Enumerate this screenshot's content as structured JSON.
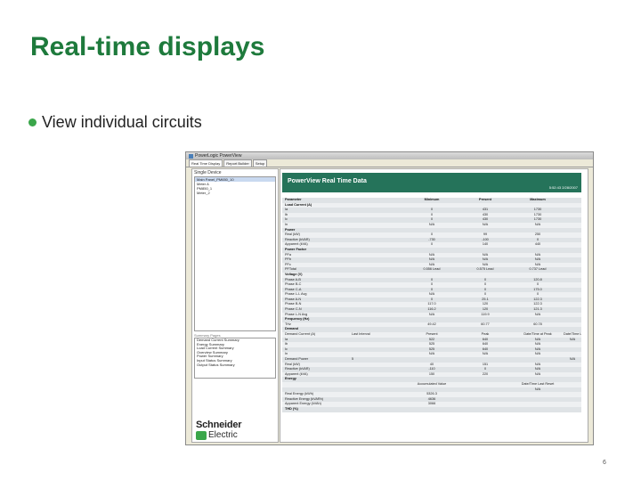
{
  "slide": {
    "title": "Real-time displays",
    "bullet": "View individual circuits",
    "number": "6",
    "accent_color": "#1e7a3c"
  },
  "window": {
    "title": "PowerLogic PowerView",
    "tabs": [
      "Real Time Display",
      "Report Builder",
      "Setup"
    ],
    "left_pane_header": "Single Device",
    "devices": [
      "Main Panel_PM650_10",
      "Meter A",
      "PM850_1",
      "Meter_2"
    ],
    "summary_header": "Summary Pages",
    "summary_pages": [
      "Demand Current Summary",
      "Energy Summary",
      "Load Current Summary",
      "Overview Summary",
      "Power Summary",
      "Input Status Summary",
      "Output Status Summary"
    ],
    "logo_line1": "Schneider",
    "logo_line2": "Electric"
  },
  "realtime": {
    "title": "PowerView Real Time Data",
    "timestamp": "5:52:43 2/28/2007",
    "headers": [
      "Parameter",
      "",
      "Minimum",
      "Present",
      "Maximum",
      ""
    ],
    "rows": [
      [
        "Load Current (A)",
        "",
        "",
        "",
        "",
        ""
      ],
      [
        "Ia",
        "",
        "0",
        "431",
        "1730",
        ""
      ],
      [
        "Ib",
        "",
        "0",
        "430",
        "1730",
        ""
      ],
      [
        "Ic",
        "",
        "0",
        "430",
        "1730",
        ""
      ],
      [
        "In",
        "",
        "N/A",
        "N/A",
        "N/A",
        ""
      ],
      [
        "Power",
        "",
        "",
        "",
        "",
        ""
      ],
      [
        "Real (kW)",
        "",
        "0",
        "99",
        "250",
        ""
      ],
      [
        "Reactive (kVAR)",
        "",
        "-730",
        "-100",
        "0",
        ""
      ],
      [
        "Apparent (kVA)",
        "",
        "0",
        "140",
        "440",
        ""
      ],
      [
        "Power Factor",
        "",
        "",
        "",
        "",
        ""
      ],
      [
        "PFa",
        "",
        "N/A",
        "N/A",
        "N/A",
        ""
      ],
      [
        "PFb",
        "",
        "N/A",
        "N/A",
        "N/A",
        ""
      ],
      [
        "PFc",
        "",
        "N/A",
        "N/A",
        "N/A",
        ""
      ],
      [
        "PFTotal",
        "",
        "0.556 Lead",
        "0.575 Lead",
        "0.737 Lead",
        ""
      ],
      [
        "Voltage (V)",
        "",
        "",
        "",
        "",
        ""
      ],
      [
        "Phase A-B",
        "",
        "0",
        "0",
        "120.8",
        ""
      ],
      [
        "Phase B-C",
        "",
        "0",
        "0",
        "0",
        ""
      ],
      [
        "Phase C-A",
        "",
        "0",
        "0",
        "175.0",
        ""
      ],
      [
        "Phase L-L Avg",
        "",
        "N/A",
        "0",
        "0",
        ""
      ],
      [
        "Phase A-N",
        "",
        "0",
        "25.1",
        "122.3",
        ""
      ],
      [
        "Phase B-N",
        "",
        "117.0",
        "120",
        "122.3",
        ""
      ],
      [
        "Phase C-N",
        "",
        "116.2",
        "120",
        "121.3",
        ""
      ],
      [
        "Phase L-N Avg",
        "",
        "N/A",
        "119.9",
        "N/A",
        ""
      ],
      [
        "Frequency (Hz)",
        "",
        "",
        "",
        "",
        ""
      ],
      [
        "THz",
        "",
        "49.42",
        "60.77",
        "60.78",
        ""
      ],
      [
        "Demand",
        "",
        "",
        "",
        "",
        ""
      ],
      [
        "Demand Current (A)",
        "Last Interval",
        "Present",
        "Peak",
        "Date/Time at Peak",
        "Date/Time Last Reset"
      ],
      [
        "Ia",
        "",
        "522",
        "640",
        "N/A",
        "N/A"
      ],
      [
        "Ib",
        "",
        "525",
        "640",
        "N/A",
        ""
      ],
      [
        "Ic",
        "",
        "525",
        "640",
        "N/A",
        ""
      ],
      [
        "In",
        "",
        "N/A",
        "N/A",
        "N/A",
        ""
      ],
      [
        "Demand Power",
        "5",
        "",
        "",
        "",
        "N/A"
      ],
      [
        "Real (kW)",
        "",
        "40",
        "151",
        "N/A",
        ""
      ],
      [
        "Reactive (kVAR)",
        "",
        "-110",
        "0",
        "N/A",
        ""
      ],
      [
        "Apparent (kVA)",
        "",
        "150",
        "220",
        "N/A",
        ""
      ],
      [
        "Energy",
        "",
        "",
        "",
        "",
        ""
      ],
      [
        "",
        "",
        "Accumulated Value",
        "",
        "Date/Time Last Reset",
        ""
      ],
      [
        "",
        "",
        "",
        "",
        "N/A",
        ""
      ],
      [
        "Real Energy (kWh)",
        "",
        "5326.3",
        "",
        "",
        ""
      ],
      [
        "Reactive Energy (kVARh)",
        "",
        "4636",
        "",
        "",
        ""
      ],
      [
        "Apparent Energy (kVAh)",
        "",
        "3066",
        "",
        "",
        ""
      ],
      [
        "THD (%)",
        "",
        "",
        "",
        "",
        ""
      ]
    ]
  }
}
